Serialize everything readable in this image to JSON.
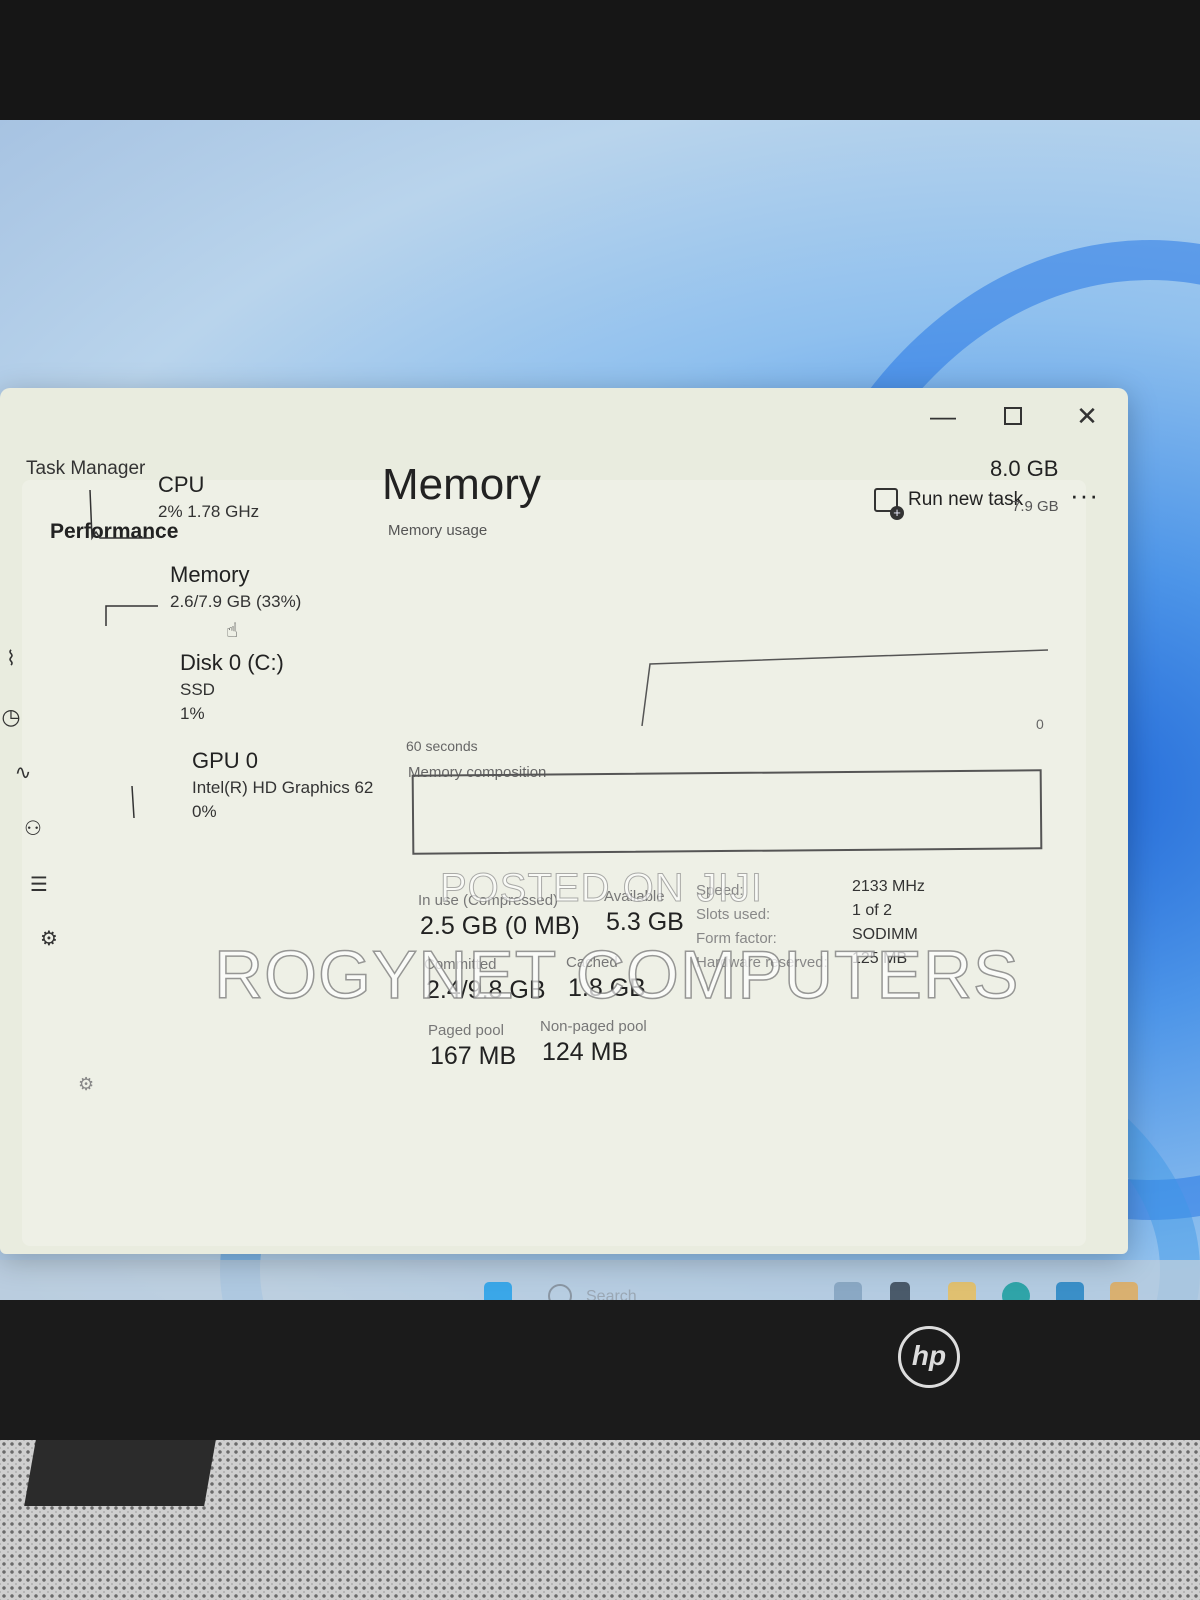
{
  "window": {
    "title": "Task Manager",
    "page_title": "Performance",
    "run_task_label": "Run new task",
    "more_label": "···"
  },
  "resources": [
    {
      "name": "CPU",
      "line1": "2% 1.78 GHz",
      "line2": ""
    },
    {
      "name": "Memory",
      "line1": "2.6/7.9 GB (33%)",
      "line2": ""
    },
    {
      "name": "Disk 0 (C:)",
      "line1": "SSD",
      "line2": "1%"
    },
    {
      "name": "GPU 0",
      "line1": "Intel(R) HD Graphics 62",
      "line2": "0%"
    }
  ],
  "memory": {
    "title": "Memory",
    "usage_label": "Memory usage",
    "total": "8.0 GB",
    "max": "7.9 GB",
    "zero": "0",
    "seconds": "60 seconds",
    "composition_label": "Memory composition",
    "in_use_label": "In use (Compressed)",
    "in_use_value": "2.5 GB (0 MB)",
    "available_label": "Available",
    "available_value": "5.3 GB",
    "committed_label": "Committed",
    "committed_value": "2.4/9.8 GB",
    "cached_label": "Cached",
    "cached_value": "1.8 GB",
    "paged_label": "Paged pool",
    "paged_value": "167 MB",
    "nonpaged_label": "Non-paged pool",
    "nonpaged_value": "124 MB",
    "speed_label": "Speed:",
    "speed_value": "2133 MHz",
    "slots_label": "Slots used:",
    "slots_value": "1 of 2",
    "form_label": "Form factor:",
    "form_value": "SODIMM",
    "reserved_label": "Hardware reserved:",
    "reserved_value": "125 MB"
  },
  "watermark": {
    "line1": "POSTED ON JIJI",
    "line2": "ROGYNET COMPUTERS"
  },
  "taskbar": {
    "search_placeholder": "Search"
  },
  "laptop": {
    "brand": "hp"
  },
  "icons": {
    "nav": [
      "performance-icon",
      "app-history-icon",
      "startup-icon",
      "users-icon",
      "details-icon",
      "services-icon"
    ]
  }
}
